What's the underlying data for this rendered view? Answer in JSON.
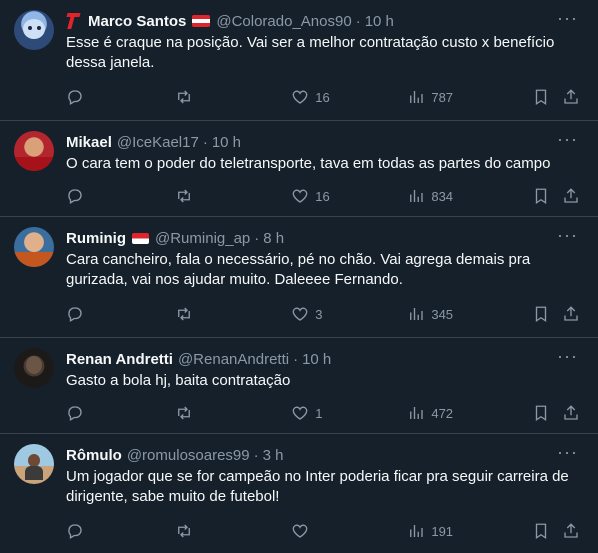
{
  "tweets": [
    {
      "name": "Marco Santos",
      "handle": "@Colorado_Anos90",
      "time": "10 h",
      "text": "Esse é craque na posição. Vai ser a melhor contratação custo x benefício dessa janela.",
      "replies": "",
      "retweets": "",
      "likes": "16",
      "views": "787"
    },
    {
      "name": "Mikael",
      "handle": "@IceKael17",
      "time": "10 h",
      "text": "O cara tem o poder do teletransporte, tava em todas as partes do campo",
      "replies": "",
      "retweets": "",
      "likes": "16",
      "views": "834"
    },
    {
      "name": "Ruminig",
      "handle": "@Ruminig_ap",
      "time": "8 h",
      "text": "Cara cancheiro, fala o necessário, pé no chão. Vai agrega demais pra gurizada, vai nos ajudar muito. Daleeee Fernando.",
      "replies": "",
      "retweets": "",
      "likes": "3",
      "views": "345"
    },
    {
      "name": "Renan Andretti",
      "handle": "@RenanAndretti",
      "time": "10 h",
      "text": "Gasto a bola hj, baita contratação",
      "replies": "",
      "retweets": "",
      "likes": "1",
      "views": "472"
    },
    {
      "name": "Rômulo",
      "handle": "@romulosoares99",
      "time": "3 h",
      "text": "Um jogador que se for campeão no Inter poderia ficar pra seguir carreira de dirigente, sabe muito de futebol!",
      "replies": "",
      "retweets": "",
      "likes": "",
      "views": "191"
    }
  ],
  "dot": "·",
  "more_glyph": "···",
  "colors": {
    "background": "#15202b",
    "muted": "#8b98a5",
    "border": "#38444d",
    "badge_red": "#e0242b"
  }
}
